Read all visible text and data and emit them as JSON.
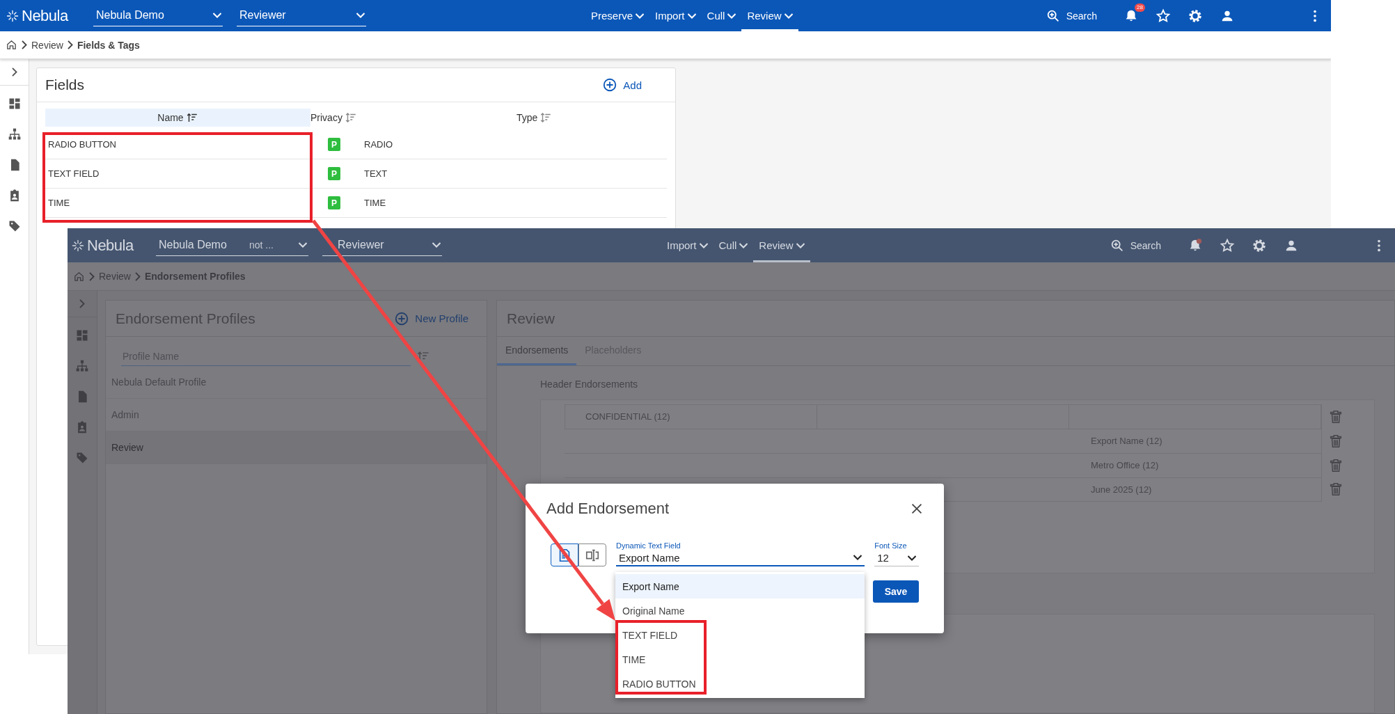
{
  "fields_screen": {
    "header": {
      "logo": "Nebula",
      "selects": [
        {
          "value": "Nebula Demo"
        },
        {
          "value": "Reviewer"
        }
      ],
      "nav": [
        {
          "label": "Preserve",
          "selected": false
        },
        {
          "label": "Import",
          "selected": false
        },
        {
          "label": "Cull",
          "selected": false
        },
        {
          "label": "Review",
          "selected": true
        }
      ],
      "search": "Search",
      "notification_badge": "28"
    },
    "breadcrumb": {
      "link": "Review",
      "current": "Fields & Tags"
    },
    "card": {
      "title": "Fields",
      "add": "Add",
      "columns": [
        {
          "label": "Name",
          "sorted": true
        },
        {
          "label": "Privacy",
          "sorted": false
        },
        {
          "label": "Type",
          "sorted": false
        }
      ],
      "rows": [
        {
          "name": "RADIO BUTTON",
          "privacy": "P",
          "type": "RADIO"
        },
        {
          "name": "TEXT FIELD",
          "privacy": "P",
          "type": "TEXT"
        },
        {
          "name": "TIME",
          "privacy": "P",
          "type": "TIME"
        }
      ]
    }
  },
  "endorsement_screen": {
    "header": {
      "logo": "Nebula",
      "selects": [
        {
          "value": "Nebula Demo",
          "suffix": "not ..."
        },
        {
          "value": "Reviewer"
        }
      ],
      "nav": [
        {
          "label": "Import",
          "selected": false
        },
        {
          "label": "Cull",
          "selected": false
        },
        {
          "label": "Review",
          "selected": true
        }
      ],
      "search": "Search"
    },
    "breadcrumb": {
      "link": "Review",
      "current": "Endorsement Profiles"
    },
    "profiles": {
      "title": "Endorsement Profiles",
      "add": "New Profile",
      "search": {
        "placeholder": "Profile Name"
      },
      "items": [
        {
          "label": "Nebula Default Profile",
          "selected": false
        },
        {
          "label": "Admin",
          "selected": false
        },
        {
          "label": "Review",
          "selected": true
        }
      ]
    },
    "review": {
      "title": "Review",
      "tabs": [
        {
          "label": "Endorsements",
          "selected": true
        },
        {
          "label": "Placeholders",
          "selected": false
        }
      ],
      "section": "Header Endorsements",
      "rows": [
        {
          "column_1": "CONFIDENTIAL (12)"
        },
        {
          "column_3": "Export Name (12)"
        },
        {
          "column_3": "Metro Office (12)"
        },
        {
          "column_3": "June 2025 (12)"
        }
      ]
    },
    "dialog": {
      "title": "Add Endorsement",
      "modes": [
        {
          "selected": true
        },
        {
          "selected": false
        }
      ],
      "field": {
        "label": "Dynamic Text Field",
        "value": "Export Name"
      },
      "font_size": {
        "label": "Font Size",
        "value": "12"
      },
      "save": "Save",
      "options": [
        {
          "label": "Export Name",
          "selected": true
        },
        {
          "label": "Original Name",
          "selected": false
        },
        {
          "label": "TEXT FIELD",
          "selected": false
        },
        {
          "label": "TIME",
          "selected": false
        },
        {
          "label": "RADIO BUTTON",
          "selected": false
        }
      ]
    }
  },
  "annotations": [
    {
      "kind": "box"
    },
    {
      "kind": "arrow"
    },
    {
      "kind": "box"
    }
  ]
}
